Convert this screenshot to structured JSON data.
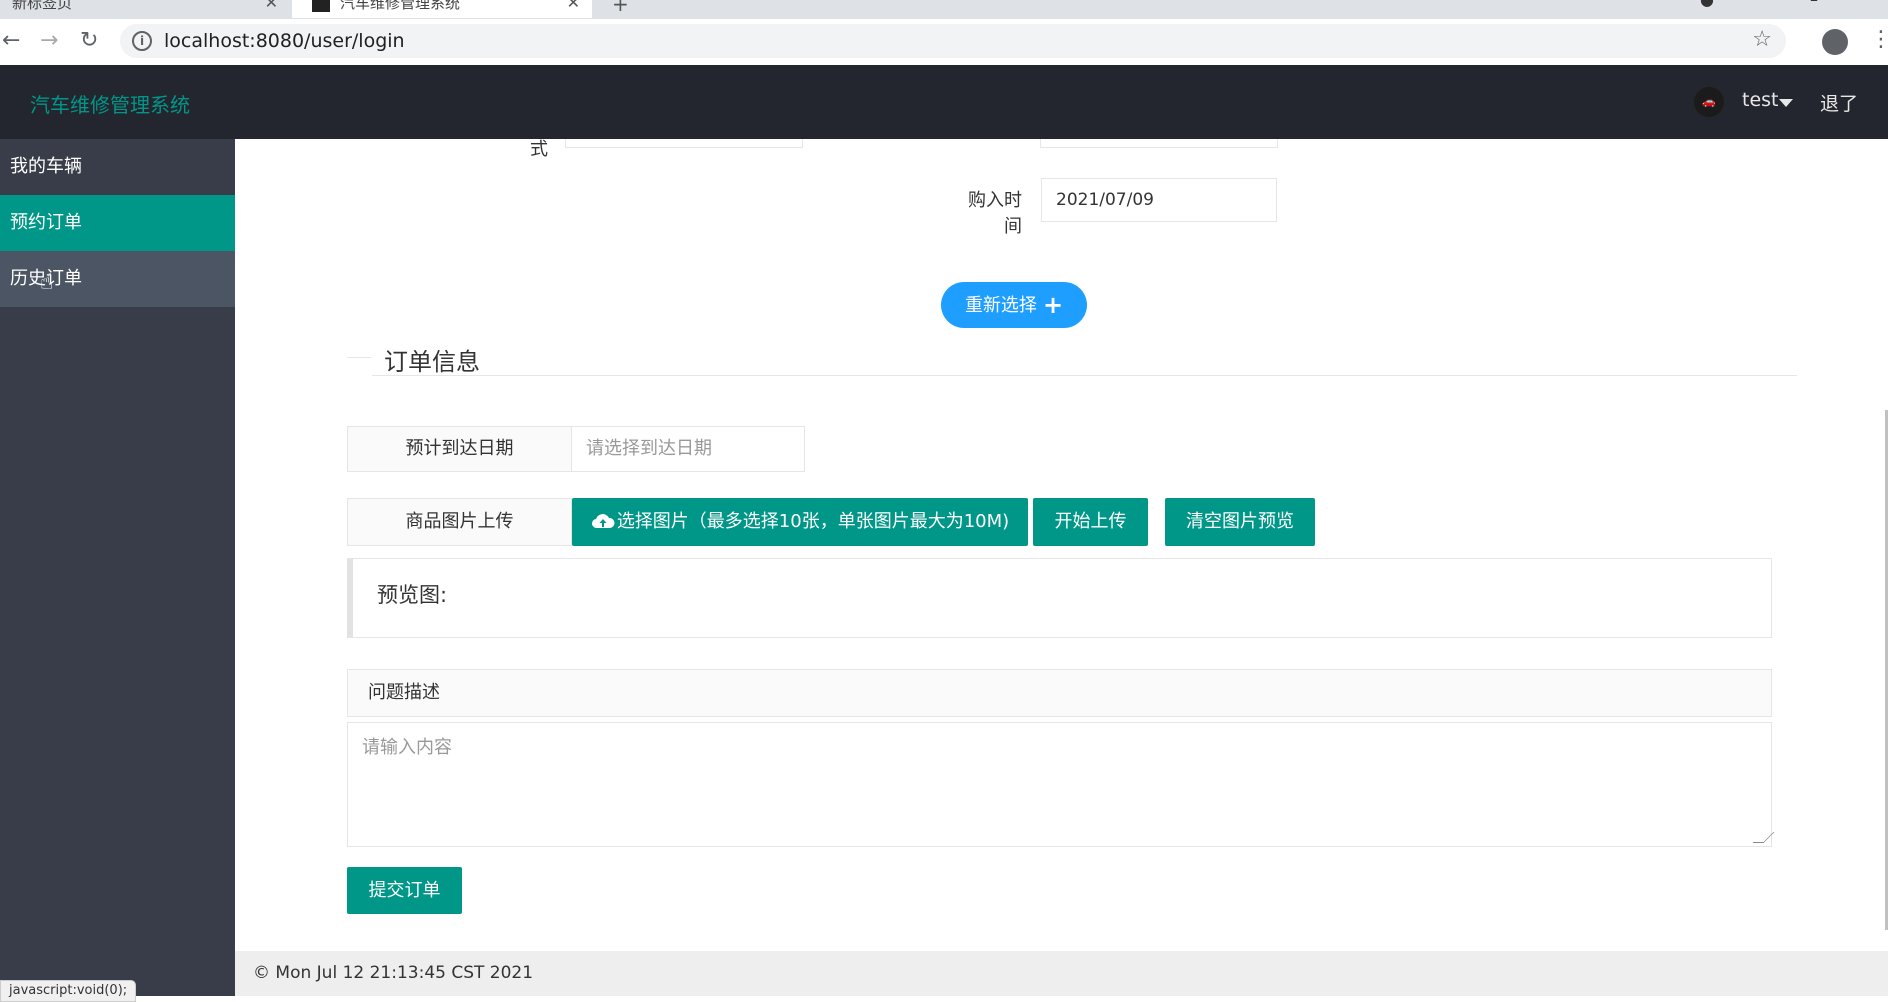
{
  "browser": {
    "tabs": [
      {
        "title": "新标签页"
      },
      {
        "title": "汽车维修管理系统"
      }
    ],
    "new_tab_icon": "plus-icon",
    "url": "localhost:8080/user/login"
  },
  "header": {
    "logo": "汽车维修管理系统",
    "user_name": "test",
    "logout": "退了"
  },
  "sidebar": {
    "items": [
      {
        "label": "我的车辆"
      },
      {
        "label": "预约订单"
      },
      {
        "label": "历史订单"
      }
    ]
  },
  "form": {
    "cut_label": "式",
    "buy_time_label": "购入时间",
    "buy_time_value": "2021/07/09",
    "reselect_label": "重新选择",
    "section_title": "订单信息",
    "arrival_label": "预计到达日期",
    "arrival_placeholder": "请选择到达日期",
    "upload_label": "商品图片上传",
    "choose_btn": "选择图片（最多选择10张，单张图片最大为10M)",
    "start_upload_btn": "开始上传",
    "clear_preview_btn": "清空图片预览",
    "preview_label": "预览图:",
    "desc_label": "问题描述",
    "desc_placeholder": "请输入内容",
    "submit_btn": "提交订单"
  },
  "footer": {
    "text": "© Mon Jul 12 21:13:45 CST 2021"
  },
  "status_bar": "javascript:void(0);",
  "colors": {
    "header_bg": "#23262e",
    "sidebar_bg": "#393d49",
    "accent_green": "#009688",
    "accent_blue": "#1e9fff"
  }
}
